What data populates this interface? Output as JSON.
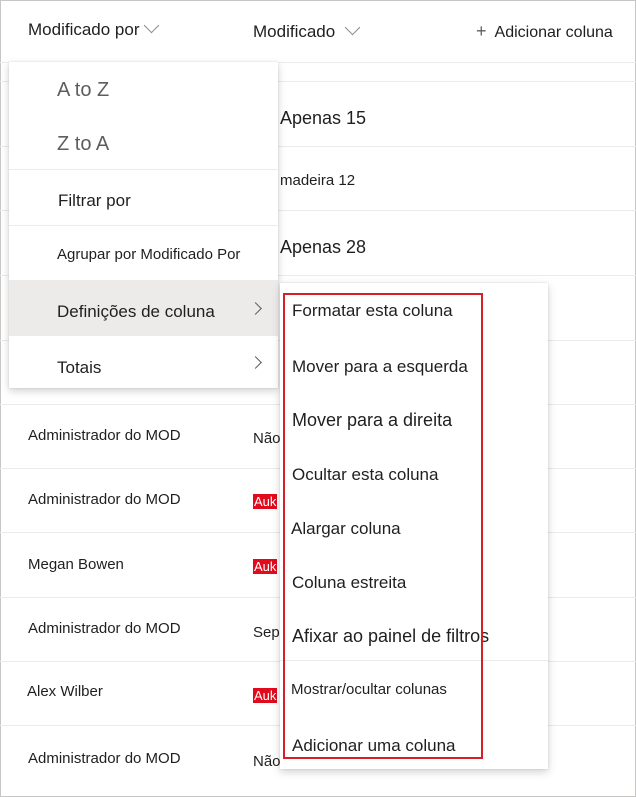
{
  "header": {
    "col_modified_by": "Modificado por",
    "col_modified": "Modificado",
    "add_column": "Adicionar coluna",
    "plus_glyph": "+"
  },
  "background_text": {
    "r1": "Apenas 15",
    "r2": "madeira 12",
    "r3": "Apenas 28"
  },
  "rows": [
    {
      "name": "Administrador do MOD",
      "modified": "Não"
    },
    {
      "name": "Administrador do MOD",
      "modified": "Auk"
    },
    {
      "name": "Megan Bowen",
      "modified": "Auk"
    },
    {
      "name": "Administrador do MOD",
      "modified": "Sep"
    },
    {
      "name": "Alex Wilber",
      "modified": "Auk"
    },
    {
      "name": "Administrador do MOD",
      "modified": "Não"
    }
  ],
  "menu": {
    "sort_az": "A to Z",
    "sort_za": "Z to A",
    "filter_by": "Filtrar por",
    "group_by": "Agrupar por Modificado Por",
    "column_settings": "Definições de coluna",
    "totals": "Totais"
  },
  "submenu": {
    "items": [
      "Formatar esta coluna",
      "Mover para a esquerda",
      "Mover para a direita",
      "Ocultar esta coluna",
      "Alargar coluna",
      "Coluna estreita",
      "Afixar ao painel de filtros",
      "Mostrar/ocultar colunas",
      "Adicionar uma coluna"
    ]
  },
  "colors": {
    "highlight_border": "#d71f27",
    "badge_red": "#e00b1c",
    "selected_bg": "#edebe9"
  },
  "icons": [
    "chevron-down-icon",
    "plus-icon",
    "chevron-right-icon"
  ]
}
